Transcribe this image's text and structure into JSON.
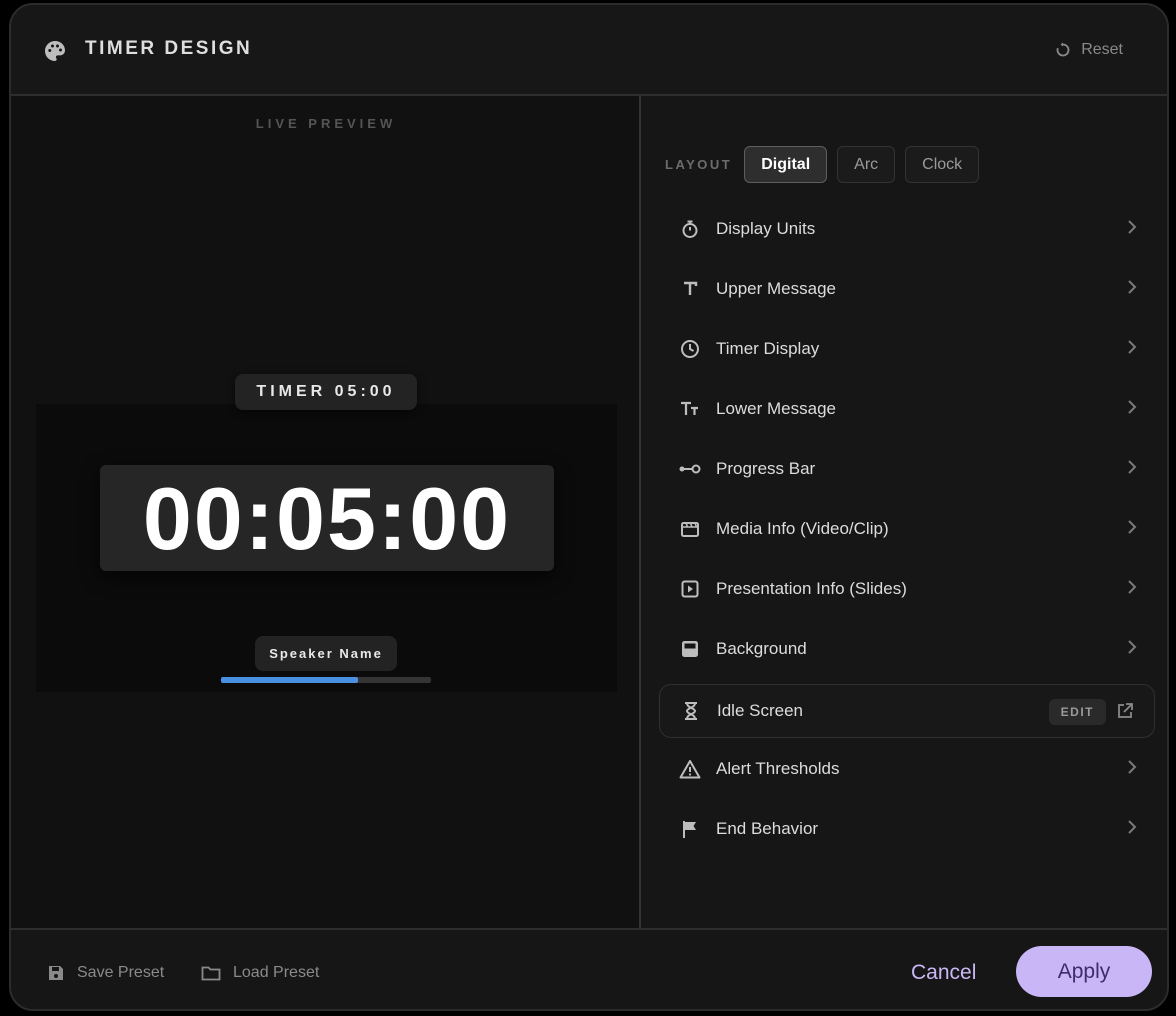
{
  "header": {
    "title": "TIMER DESIGN",
    "reset_label": "Reset"
  },
  "preview": {
    "label": "LIVE PREVIEW",
    "top_tag": "TIMER 05:00",
    "time": "00:05:00",
    "bottom_tag": "Speaker Name",
    "progress": 0.65,
    "progress_color": "#4a90e2"
  },
  "layout": {
    "label": "LAYOUT",
    "options": [
      "Digital",
      "Arc",
      "Clock"
    ],
    "selected": "Digital"
  },
  "items": [
    {
      "label": "Display Units",
      "icon": "stopwatch-icon"
    },
    {
      "label": "Upper Message",
      "icon": "text-icon"
    },
    {
      "label": "Timer Display",
      "icon": "clock-icon"
    },
    {
      "label": "Lower Message",
      "icon": "text-size-icon"
    },
    {
      "label": "Progress Bar",
      "icon": "progress-icon"
    },
    {
      "label": "Media Info (Video/Clip)",
      "icon": "clapperboard-icon"
    },
    {
      "label": "Presentation Info (Slides)",
      "icon": "play-square-icon"
    },
    {
      "label": "Background",
      "icon": "background-icon"
    },
    {
      "label": "Idle Screen",
      "icon": "hourglass-icon",
      "edit_label": "EDIT"
    },
    {
      "label": "Alert Thresholds",
      "icon": "warning-icon"
    },
    {
      "label": "End Behavior",
      "icon": "flag-icon"
    }
  ],
  "footer": {
    "save_preset": "Save Preset",
    "load_preset": "Load Preset",
    "cancel": "Cancel",
    "apply": "Apply"
  },
  "colors": {
    "accent": "#c9b6f7",
    "accent_text": "#3b2e6b",
    "background": "#161616"
  }
}
